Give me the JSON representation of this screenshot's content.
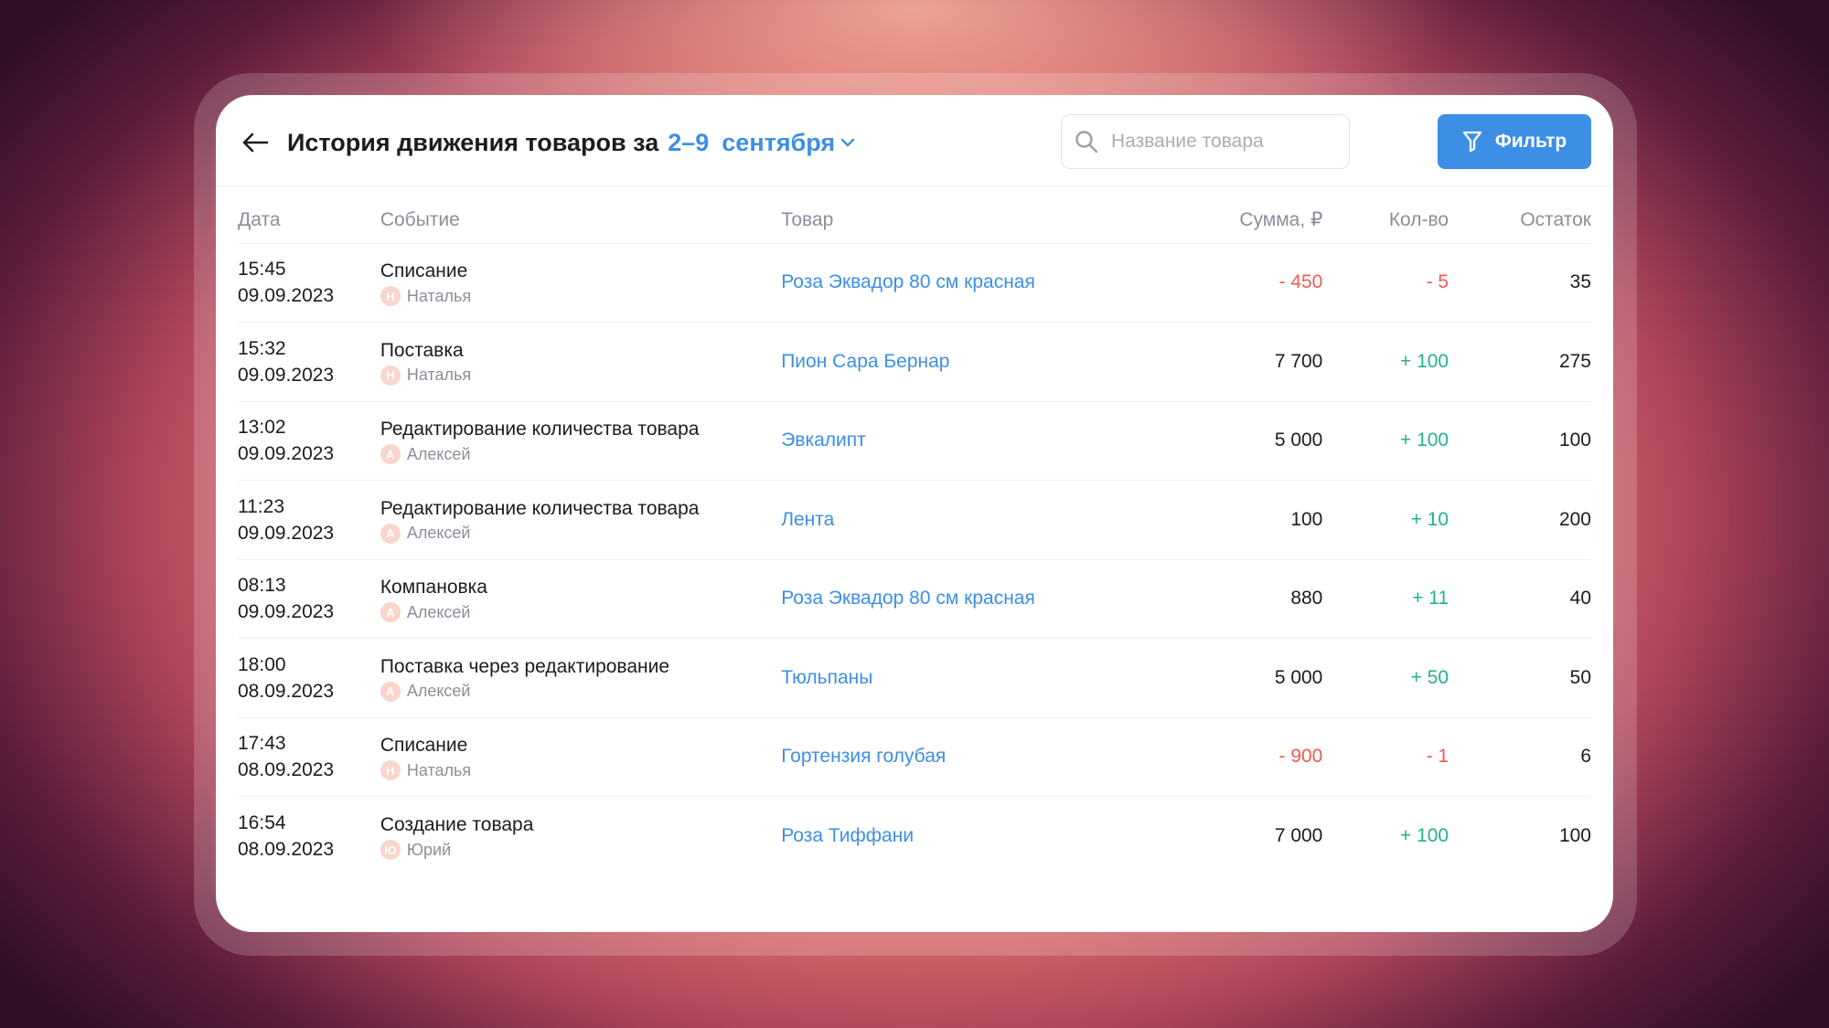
{
  "header": {
    "title": "История движения товаров за",
    "date_range": "2–9",
    "month": "сентября",
    "search_placeholder": "Название товара",
    "filter_label": "Фильтр"
  },
  "columns": {
    "date": "Дата",
    "event": "Событие",
    "product": "Товар",
    "sum": "Сумма, ₽",
    "qty": "Кол-во",
    "rest": "Остаток"
  },
  "colors": {
    "accent": "#3d8fe6",
    "negative": "#ef5b4f",
    "positive": "#22b28c"
  },
  "rows": [
    {
      "time": "15:45",
      "date": "09.09.2023",
      "event": "Списание",
      "avatar": "Н",
      "user": "Наталья",
      "product": "Роза Эквадор 80 см красная",
      "sum": "- 450",
      "sum_type": "neg",
      "qty": "- 5",
      "qty_type": "neg",
      "rest": "35"
    },
    {
      "time": "15:32",
      "date": "09.09.2023",
      "event": "Поставка",
      "avatar": "Н",
      "user": "Наталья",
      "product": "Пион Сара Бернар",
      "sum": "7 700",
      "sum_type": "plain",
      "qty": "+ 100",
      "qty_type": "pos",
      "rest": "275"
    },
    {
      "time": "13:02",
      "date": "09.09.2023",
      "event": "Редактирование количества товара",
      "avatar": "А",
      "user": "Алексей",
      "product": "Эвкалипт",
      "sum": "5 000",
      "sum_type": "plain",
      "qty": "+ 100",
      "qty_type": "pos",
      "rest": "100"
    },
    {
      "time": "11:23",
      "date": "09.09.2023",
      "event": "Редактирование количества товара",
      "avatar": "А",
      "user": "Алексей",
      "product": "Лента",
      "sum": "100",
      "sum_type": "plain",
      "qty": "+ 10",
      "qty_type": "pos",
      "rest": "200"
    },
    {
      "time": "08:13",
      "date": "09.09.2023",
      "event": "Компановка",
      "avatar": "А",
      "user": "Алексей",
      "product": "Роза Эквадор 80 см красная",
      "sum": "880",
      "sum_type": "plain",
      "qty": "+ 11",
      "qty_type": "pos",
      "rest": "40"
    },
    {
      "time": "18:00",
      "date": "08.09.2023",
      "event": "Поставка через редактирование",
      "avatar": "А",
      "user": "Алексей",
      "product": "Тюльпаны",
      "sum": "5 000",
      "sum_type": "plain",
      "qty": "+ 50",
      "qty_type": "pos",
      "rest": "50"
    },
    {
      "time": "17:43",
      "date": "08.09.2023",
      "event": "Списание",
      "avatar": "Н",
      "user": "Наталья",
      "product": "Гортензия голубая",
      "sum": "- 900",
      "sum_type": "neg",
      "qty": "- 1",
      "qty_type": "neg",
      "rest": "6"
    },
    {
      "time": "16:54",
      "date": "08.09.2023",
      "event": "Создание товара",
      "avatar": "Ю",
      "user": "Юрий",
      "product": "Роза Тиффани",
      "sum": "7 000",
      "sum_type": "plain",
      "qty": "+ 100",
      "qty_type": "pos",
      "rest": "100"
    }
  ]
}
